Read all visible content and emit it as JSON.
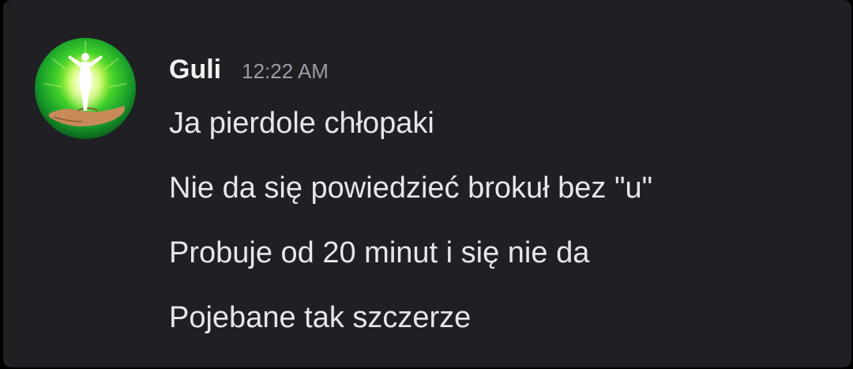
{
  "message": {
    "author": "Guli",
    "timestamp": "12:22 AM",
    "avatar_icon": "glowing-figure-on-hand-icon",
    "lines": [
      "Ja pierdole chłopaki",
      "Nie da się powiedzieć brokuł bez \"u\"",
      "Probuje od 20 minut i się nie da",
      "Pojebane tak szczerze"
    ]
  },
  "colors": {
    "background": "#1f1f24",
    "username": "#f2f3f5",
    "timestamp": "#9a9ca6",
    "message_text": "#e6e7ea",
    "avatar_glow": "#3fcf2a"
  }
}
